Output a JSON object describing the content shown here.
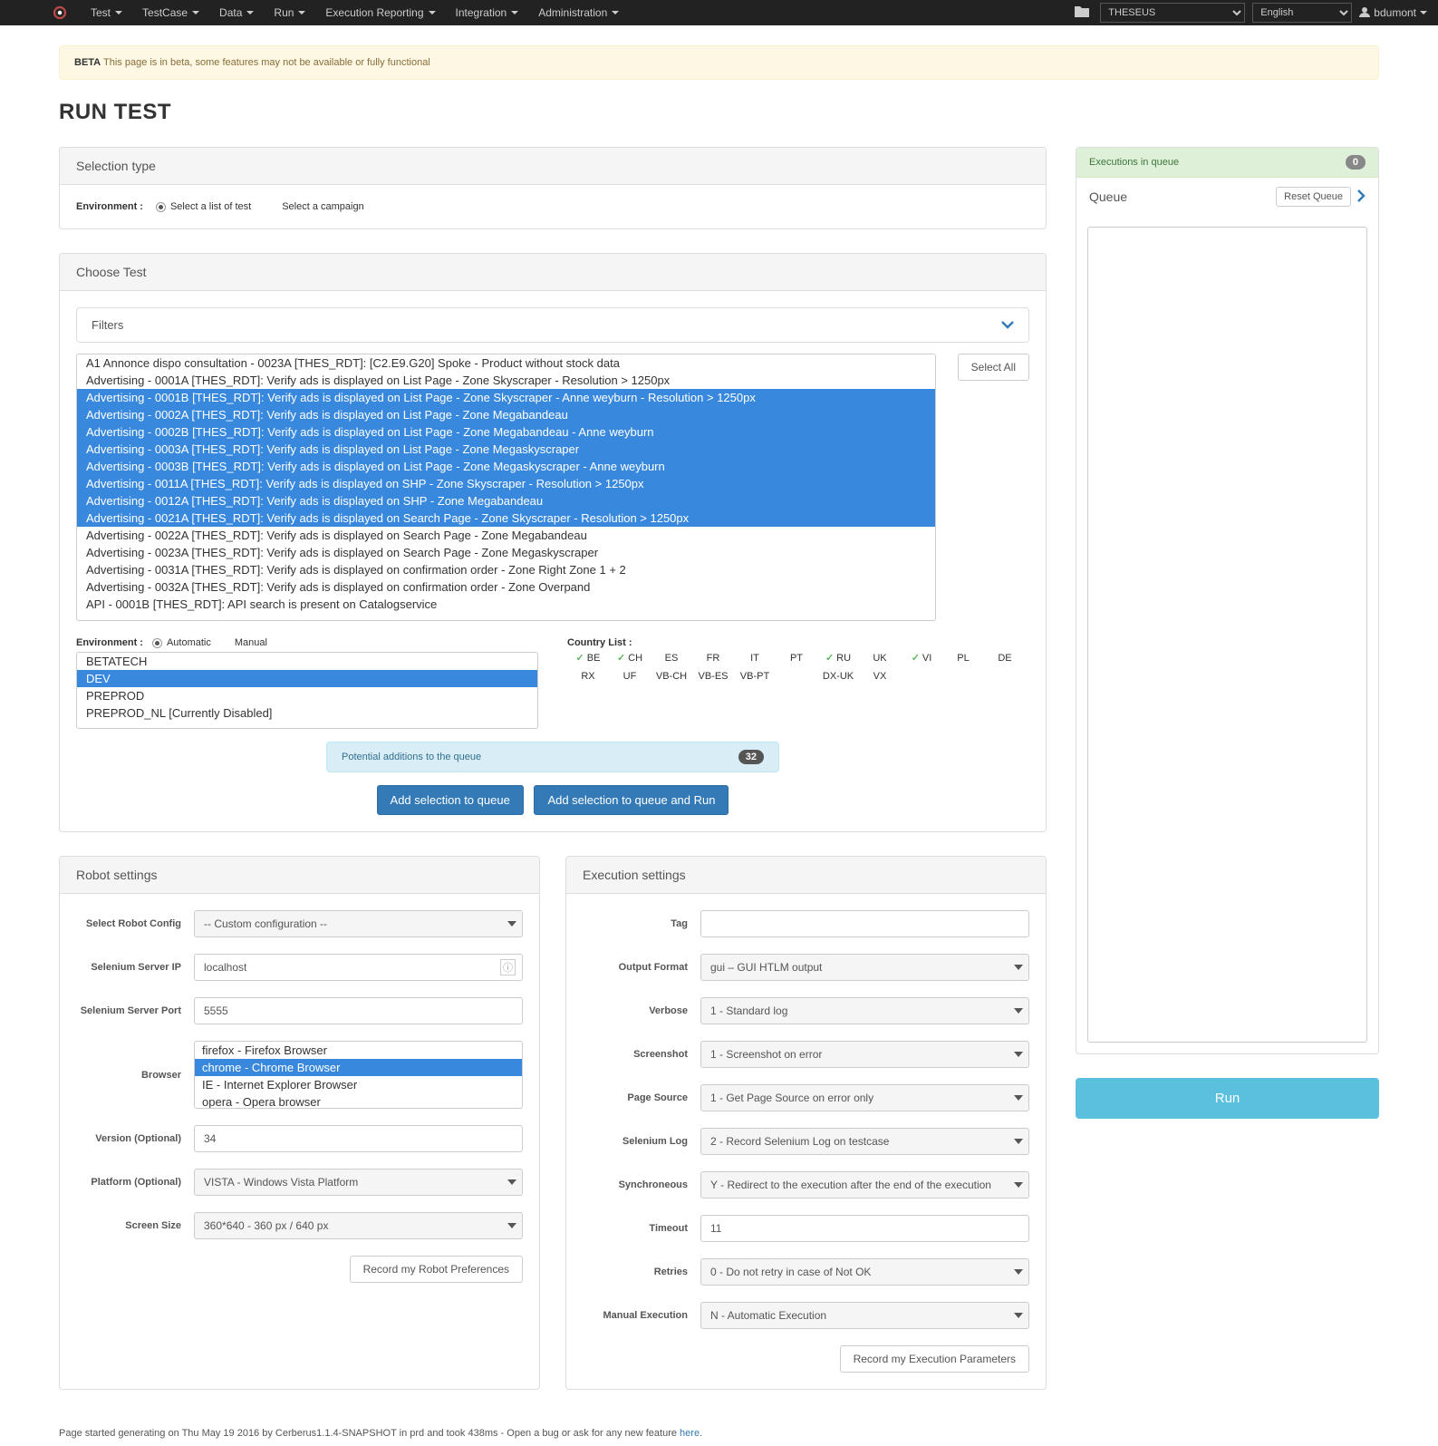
{
  "nav": {
    "items": [
      "Test",
      "TestCase",
      "Data",
      "Run",
      "Execution Reporting",
      "Integration",
      "Administration"
    ],
    "system_select": "THESEUS",
    "lang_select": "English",
    "user": "bdumont"
  },
  "alert": {
    "strong": "BETA",
    "text": "This page is in beta, some features may not be available or fully functional"
  },
  "page_title": "RUN TEST",
  "selection_type": {
    "heading": "Selection type",
    "label": "Environment :",
    "opt_list": "Select a list of test",
    "opt_campaign": "Select a campaign"
  },
  "choose_test": {
    "heading": "Choose Test",
    "filters_label": "Filters",
    "tests": [
      {
        "t": "A1 Annonce dispo consultation - 0023A [THES_RDT]: [C2.E9.G20] Spoke - Product without stock data",
        "sel": false
      },
      {
        "t": "Advertising - 0001A [THES_RDT]: Verify ads is displayed on List Page - Zone Skyscraper - Resolution > 1250px",
        "sel": false
      },
      {
        "t": "Advertising - 0001B [THES_RDT]: Verify ads is displayed on List Page - Zone Skyscraper - Anne weyburn - Resolution > 1250px",
        "sel": true
      },
      {
        "t": "Advertising - 0002A [THES_RDT]: Verify ads is displayed on List Page - Zone Megabandeau",
        "sel": true
      },
      {
        "t": "Advertising - 0002B [THES_RDT]: Verify ads is displayed on List Page - Zone Megabandeau - Anne weyburn",
        "sel": true
      },
      {
        "t": "Advertising - 0003A [THES_RDT]: Verify ads is displayed on List Page - Zone Megaskyscraper",
        "sel": true
      },
      {
        "t": "Advertising - 0003B [THES_RDT]: Verify ads is displayed on List Page - Zone Megaskyscraper - Anne weyburn",
        "sel": true
      },
      {
        "t": "Advertising - 0011A [THES_RDT]: Verify ads is displayed on SHP - Zone Skyscraper - Resolution > 1250px",
        "sel": true
      },
      {
        "t": "Advertising - 0012A [THES_RDT]: Verify ads is displayed on SHP - Zone Megabandeau",
        "sel": true
      },
      {
        "t": "Advertising - 0021A [THES_RDT]: Verify ads is displayed on Search Page - Zone Skyscraper - Resolution > 1250px",
        "sel": true
      },
      {
        "t": "Advertising - 0022A [THES_RDT]: Verify ads is displayed on Search Page - Zone Megabandeau",
        "sel": false
      },
      {
        "t": "Advertising - 0023A [THES_RDT]: Verify ads is displayed on Search Page - Zone Megaskyscraper",
        "sel": false
      },
      {
        "t": "Advertising - 0031A [THES_RDT]: Verify ads is displayed on confirmation order - Zone Right Zone 1 + 2",
        "sel": false
      },
      {
        "t": "Advertising - 0032A [THES_RDT]: Verify ads is displayed on confirmation order - Zone Overpand",
        "sel": false
      },
      {
        "t": "API - 0001B [THES_RDT]: API search is present on Catalogservice",
        "sel": false
      }
    ],
    "select_all": "Select All",
    "env_label": "Environment :",
    "auto": "Automatic",
    "manual": "Manual",
    "envs": [
      {
        "t": "BETATECH",
        "sel": false
      },
      {
        "t": "DEV",
        "sel": true
      },
      {
        "t": "PREPROD",
        "sel": false
      },
      {
        "t": "PREPROD_NL [Currently Disabled]",
        "sel": false
      }
    ],
    "country_label": "Country List :",
    "countries_row1": [
      {
        "c": "BE",
        "chk": true
      },
      {
        "c": "CH",
        "chk": true
      },
      {
        "c": "ES",
        "chk": false
      },
      {
        "c": "FR",
        "chk": false
      },
      {
        "c": "IT",
        "chk": false
      },
      {
        "c": "PT",
        "chk": false
      },
      {
        "c": "RU",
        "chk": true
      },
      {
        "c": "UK",
        "chk": false
      }
    ],
    "countries_row1b": [
      {
        "c": "VI",
        "chk": true
      },
      {
        "c": "PL",
        "chk": false
      },
      {
        "c": "DE",
        "chk": false
      }
    ],
    "countries_row2": [
      "RX",
      "UF",
      "VB-CH",
      "VB-ES",
      "VB-PT",
      "DX-UK"
    ],
    "countries_row2b": [
      "VX"
    ],
    "potential_label": "Potential additions to the queue",
    "potential_count": "32",
    "add_queue": "Add selection to queue",
    "add_run": "Add selection to queue and Run"
  },
  "robot": {
    "heading": "Robot settings",
    "config_label": "Select Robot Config",
    "config_value": "-- Custom configuration --",
    "ip_label": "Selenium Server IP",
    "ip_value": "localhost",
    "port_label": "Selenium Server Port",
    "port_value": "5555",
    "browser_label": "Browser",
    "browsers": [
      {
        "t": "firefox - Firefox Browser",
        "sel": false
      },
      {
        "t": "chrome - Chrome Browser",
        "sel": true
      },
      {
        "t": "IE - Internet Explorer Browser",
        "sel": false
      },
      {
        "t": "opera - Opera browser",
        "sel": false
      }
    ],
    "version_label": "Version (Optional)",
    "version_value": "34",
    "platform_label": "Platform (Optional)",
    "platform_value": "VISTA - Windows Vista Platform",
    "screen_label": "Screen Size",
    "screen_value": "360*640 - 360 px / 640 px",
    "record_btn": "Record my Robot Preferences"
  },
  "exec": {
    "heading": "Execution settings",
    "tag_label": "Tag",
    "tag_value": "",
    "output_label": "Output Format",
    "output_value": "gui – GUI HTLM output",
    "verbose_label": "Verbose",
    "verbose_value": "1 - Standard log",
    "screenshot_label": "Screenshot",
    "screenshot_value": "1 - Screenshot on error",
    "pagesource_label": "Page Source",
    "pagesource_value": "1 - Get Page Source on error only",
    "selenium_label": "Selenium Log",
    "selenium_value": "2 - Record Selenium Log on testcase",
    "sync_label": "Synchroneous",
    "sync_value": "Y - Redirect to the execution after the end of the execution",
    "timeout_label": "Timeout",
    "timeout_value": "11",
    "retries_label": "Retries",
    "retries_value": "0 - Do not retry in case of Not OK",
    "manual_label": "Manual Execution",
    "manual_value": "N - Automatic Execution",
    "record_btn": "Record my Execution Parameters"
  },
  "side": {
    "exec_in_queue": "Executions in queue",
    "exec_count": "0",
    "queue_label": "Queue",
    "reset": "Reset Queue",
    "run": "Run"
  },
  "footer": {
    "text": "Page started generating on Thu May 19 2016 by Cerberus1.1.4-SNAPSHOT in prd and took 438ms - Open a bug or ask for any new feature ",
    "link": "here"
  }
}
